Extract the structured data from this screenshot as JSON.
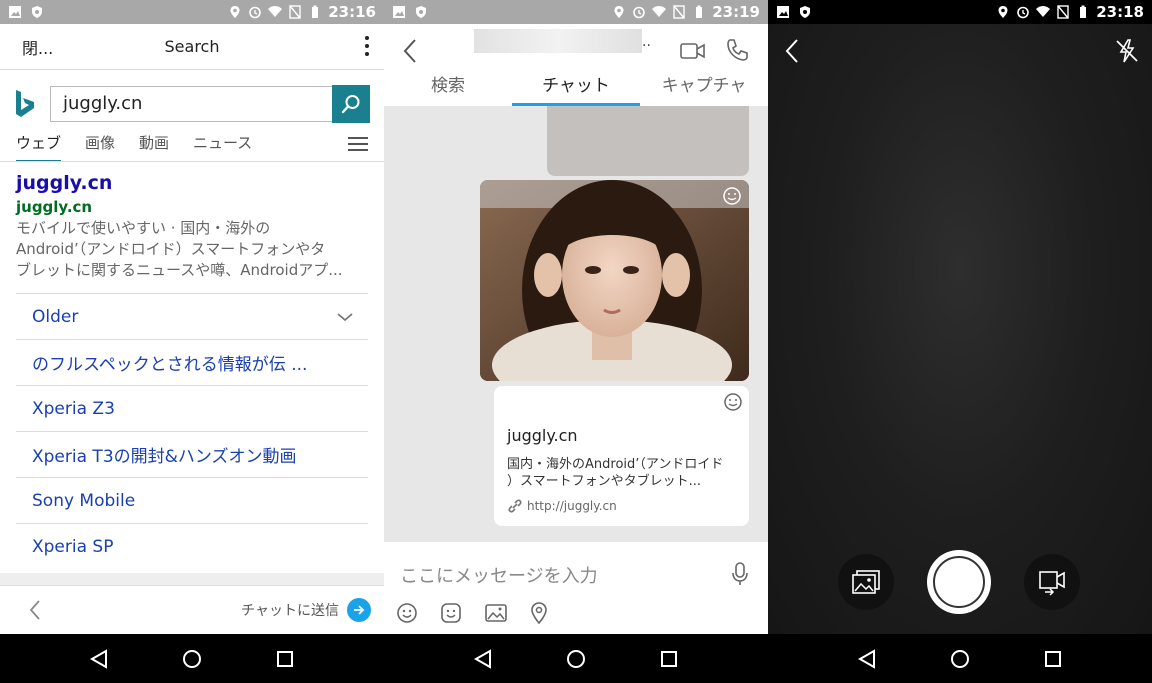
{
  "screen1": {
    "status": {
      "time": "23:16"
    },
    "header": {
      "close": "閉...",
      "title": "Search"
    },
    "search": {
      "query": "juggly.cn"
    },
    "tabs": [
      "ウェブ",
      "画像",
      "動画",
      "ニュース"
    ],
    "result": {
      "title": "juggly.cn",
      "url": "juggly.cn",
      "desc1": "モバイルで使いやすい · 国内・海外の",
      "desc2": "Android’（アンドロイド）スマートフォンやタ",
      "desc3": "ブレットに関するニュースや噂、Androidアプ..."
    },
    "links": [
      "Older",
      "のフルスペックとされる情報が伝 ...",
      "Xperia Z3",
      "Xperia T3の開封&ハンズオン動画",
      "Sony Mobile",
      "Xperia SP"
    ],
    "bottom": {
      "send": "チャットに送信"
    },
    "accent": "#1a7f8f"
  },
  "screen2": {
    "status": {
      "time": "23:19"
    },
    "header": {
      "dots": ".."
    },
    "tabs": [
      "検索",
      "チャット",
      "キャプチャ"
    ],
    "card": {
      "title": "juggly.cn",
      "desc1": "国内・海外のAndroid’（アンドロイド",
      "desc2": "）スマートフォンやタブレット...",
      "url": "http://juggly.cn"
    },
    "compose": {
      "placeholder": "ここにメッセージを入力"
    },
    "accent": "#1aa3e8"
  },
  "screen3": {
    "status": {
      "time": "23:18"
    }
  }
}
